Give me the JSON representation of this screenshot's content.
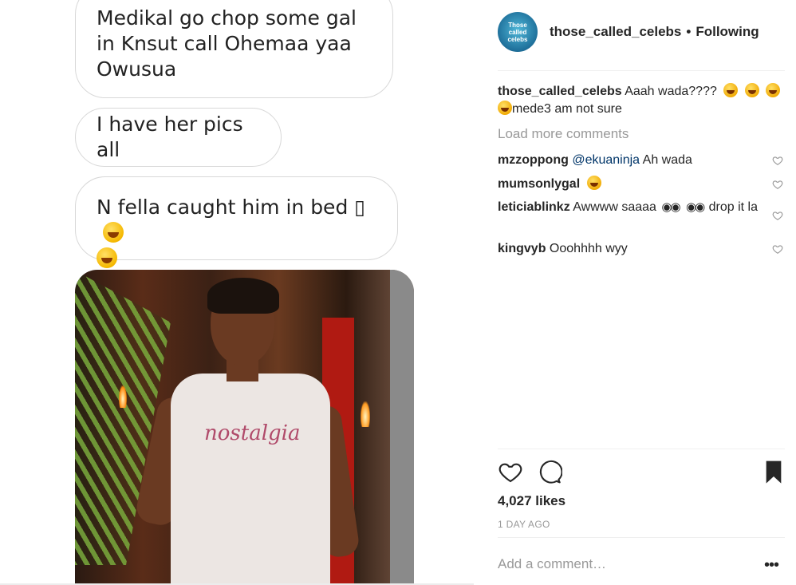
{
  "chat": {
    "message1": "Medikal go chop some gal in Knsut call Ohemaa yaa Owusua",
    "message2": "I have her pics all",
    "message3": "N fella caught him in bed ▯",
    "photo_shirt_text": "nostalgia"
  },
  "post": {
    "avatar_text": [
      "Those",
      "called",
      "celebs"
    ],
    "username": "those_called_celebs",
    "separator": "•",
    "follow_status": "Following",
    "caption_user": "those_called_celebs",
    "caption_text": "Aaah wada????",
    "caption_text2": "mede3 am not sure",
    "load_more": "Load more comments",
    "comments": [
      {
        "user": "mzzoppong",
        "mention": "@ekuaninja",
        "text": "Ah wada"
      },
      {
        "user": "mumsonlygal",
        "mention": "",
        "text": ""
      },
      {
        "user": "leticiablinkz",
        "mention": "",
        "text": "Awwww saaaa",
        "text2": "drop it la"
      },
      {
        "user": "kingvyb",
        "mention": "",
        "text": "Ooohhhh wyy"
      }
    ],
    "likes": "4,027 likes",
    "time_ago": "1 DAY AGO",
    "add_comment_placeholder": "Add a comment…",
    "more_icon": "•••"
  },
  "icons": {
    "heart": "heart-icon",
    "comment": "comment-icon",
    "bookmark": "bookmark-icon",
    "more": "more-options-icon"
  },
  "colors": {
    "mention": "#003569",
    "muted": "#999999",
    "text": "#262626"
  }
}
